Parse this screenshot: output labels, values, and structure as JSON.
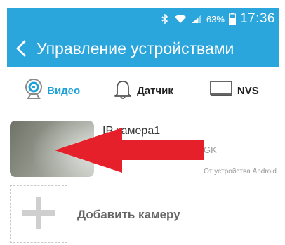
{
  "status_bar": {
    "battery_percent": "63%",
    "time": "17:36",
    "icons": [
      "bluetooth-icon",
      "wifi-icon",
      "signal-icon",
      "battery-icon"
    ]
  },
  "app_bar": {
    "back_icon": "back-arrow-icon",
    "title": "Управление устройствами",
    "color": "#2ba6dd"
  },
  "tabs": [
    {
      "label": "Видео",
      "icon": "webcam-icon",
      "active": true
    },
    {
      "label": "Датчик",
      "icon": "bell-icon",
      "active": false
    },
    {
      "label": "NVS",
      "icon": "monitor-icon",
      "active": false
    }
  ],
  "camera": {
    "name": "IP камера1",
    "id_suffix": "GK",
    "source": "От устройства Android"
  },
  "add_camera": {
    "label": "Добавить камеру",
    "icon": "plus-icon"
  },
  "annotation_arrow_color": "#e5202a"
}
